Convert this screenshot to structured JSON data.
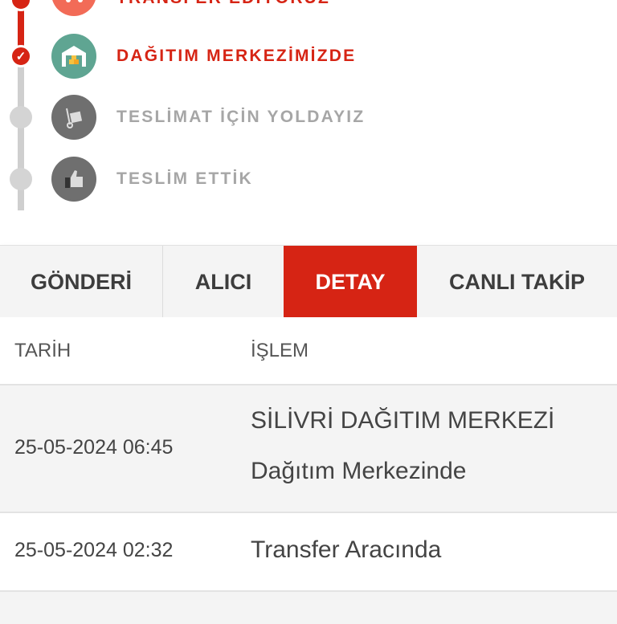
{
  "timeline": {
    "steps": [
      {
        "label": "TRANSFER EDİYORUZ",
        "status": "done",
        "icon": "transfer-truck-icon"
      },
      {
        "label": "DAĞITIM MERKEZİMİZDE",
        "status": "current",
        "icon": "warehouse-icon"
      },
      {
        "label": "TESLİMAT İÇİN YOLDAYIZ",
        "status": "pending",
        "icon": "hand-truck-icon"
      },
      {
        "label": "TESLİM ETTİK",
        "status": "pending",
        "icon": "thumbs-up-icon"
      }
    ],
    "check_glyph": "✓"
  },
  "tabs": [
    {
      "label": "GÖNDERİ",
      "active": false
    },
    {
      "label": "ALICI",
      "active": false
    },
    {
      "label": "DETAY",
      "active": true
    },
    {
      "label": "CANLI TAKİP",
      "active": false
    }
  ],
  "table": {
    "headers": {
      "date": "TARİH",
      "operation": "İŞLEM"
    },
    "rows": [
      {
        "date": "25-05-2024 06:45",
        "location": "SİLİVRİ DAĞITIM MERKEZİ",
        "status": "Dağıtım Merkezinde"
      },
      {
        "date": "25-05-2024 02:32",
        "status": "Transfer Aracında"
      }
    ]
  },
  "colors": {
    "accent": "#d62414",
    "pending": "#cfcfcf",
    "row_alt": "#f4f4f4"
  }
}
